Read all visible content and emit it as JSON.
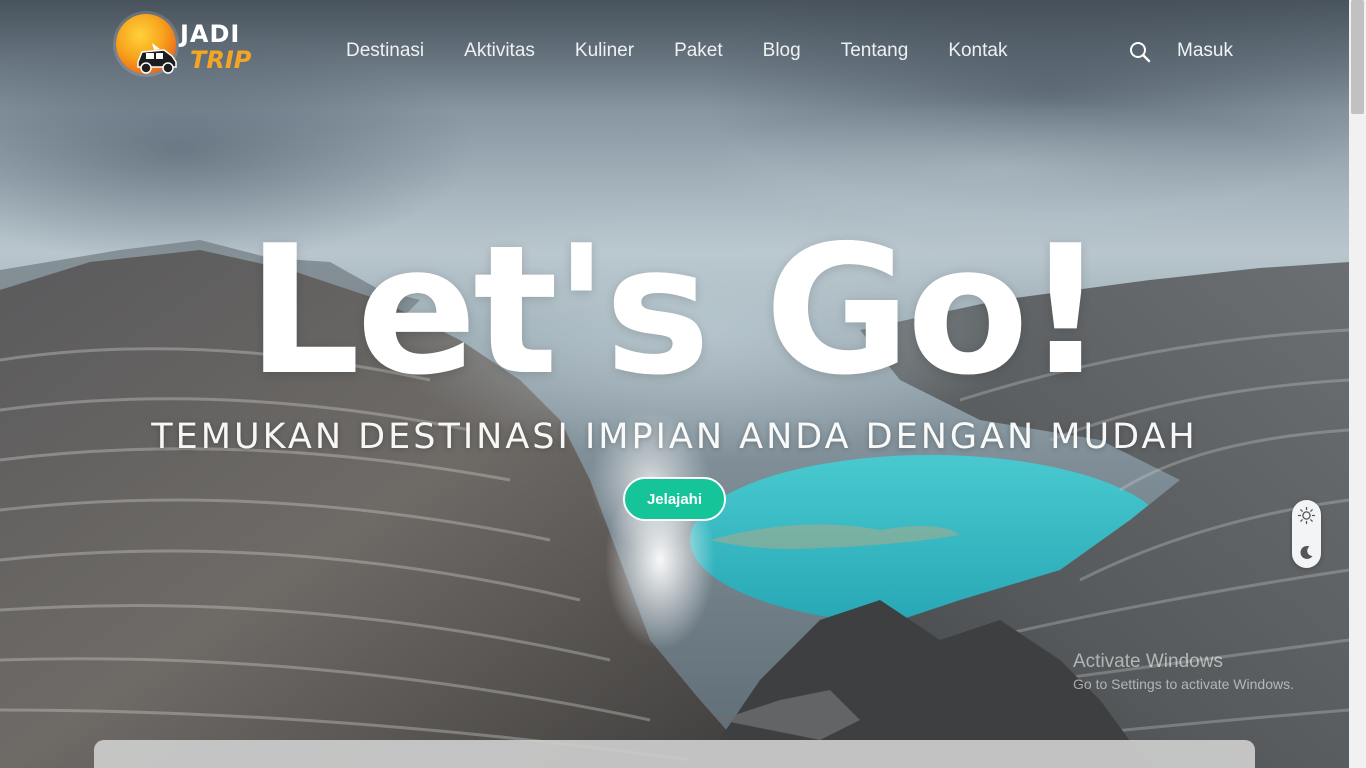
{
  "brand": {
    "name_line1": "JADI",
    "name_line2": "TRIP",
    "colors": {
      "orange": "#f5a524",
      "red": "#e3411c",
      "yellow": "#ffd23a"
    }
  },
  "nav": {
    "items": [
      {
        "label": "Destinasi"
      },
      {
        "label": "Aktivitas"
      },
      {
        "label": "Kuliner"
      },
      {
        "label": "Paket"
      },
      {
        "label": "Blog"
      },
      {
        "label": "Tentang"
      },
      {
        "label": "Kontak"
      }
    ],
    "search_icon": "search-icon",
    "login_label": "Masuk"
  },
  "hero": {
    "title": "Let's Go!",
    "subtitle": "TEMUKAN DESTINASI IMPIAN ANDA DENGAN MUDAH",
    "cta_label": "Jelajahi",
    "cta_color": "#16c49a"
  },
  "theme_toggle": {
    "light_icon": "sun-icon",
    "dark_icon": "moon-icon"
  },
  "watermark": {
    "line1": "Activate Windows",
    "line2": "Go to Settings to activate Windows."
  }
}
